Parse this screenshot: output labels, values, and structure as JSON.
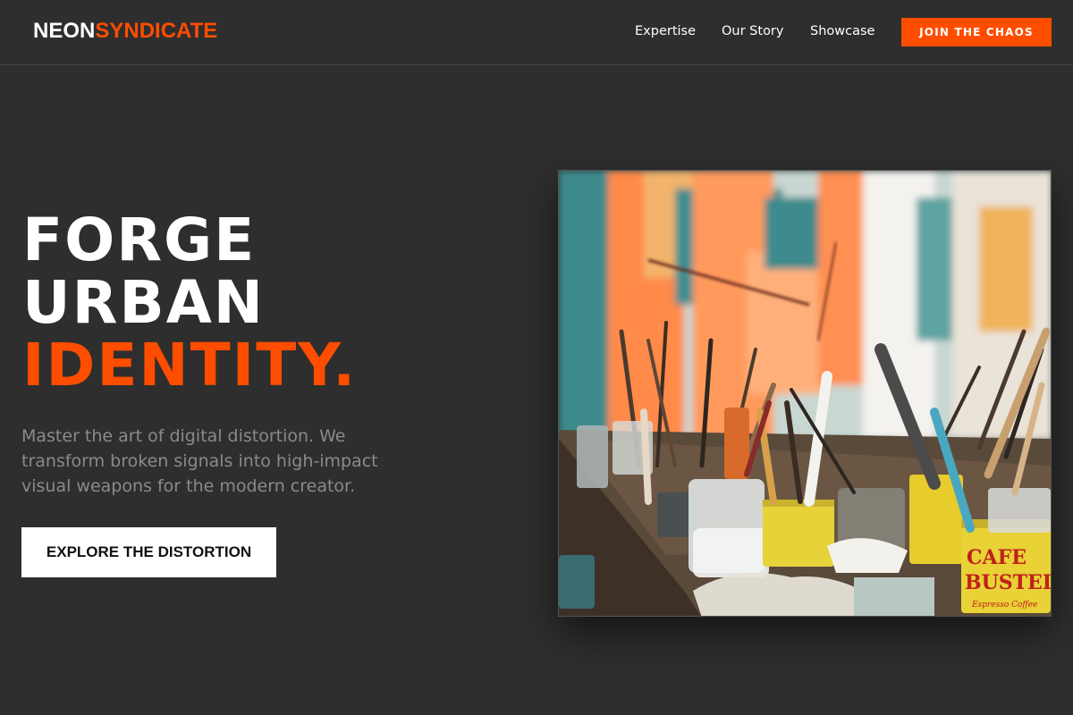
{
  "header": {
    "logo_part1": "NEON",
    "logo_part2": "SYNDICATE",
    "nav": [
      "Expertise",
      "Our Story",
      "Showcase"
    ],
    "cta_label": "JOIN THE CHAOS"
  },
  "hero": {
    "headline_line1": "FORGE",
    "headline_line2": "URBAN",
    "headline_line3": "IDENTITY.",
    "subtitle": "Master the art of digital distortion. We transform broken signals into high-impact visual weapons for the modern creator.",
    "cta_label": "EXPLORE THE DISTORTION"
  },
  "image": {
    "subject": "art studio table with paint brushes in cans",
    "can_label_top": "CAFE",
    "can_label_bottom": "BUSTELO",
    "can_small_text": "Espresso Coffee"
  },
  "colors": {
    "accent": "#ff4d00",
    "background": "#2e2e2e",
    "text": "#ffffff",
    "muted": "#8a8a8a"
  }
}
